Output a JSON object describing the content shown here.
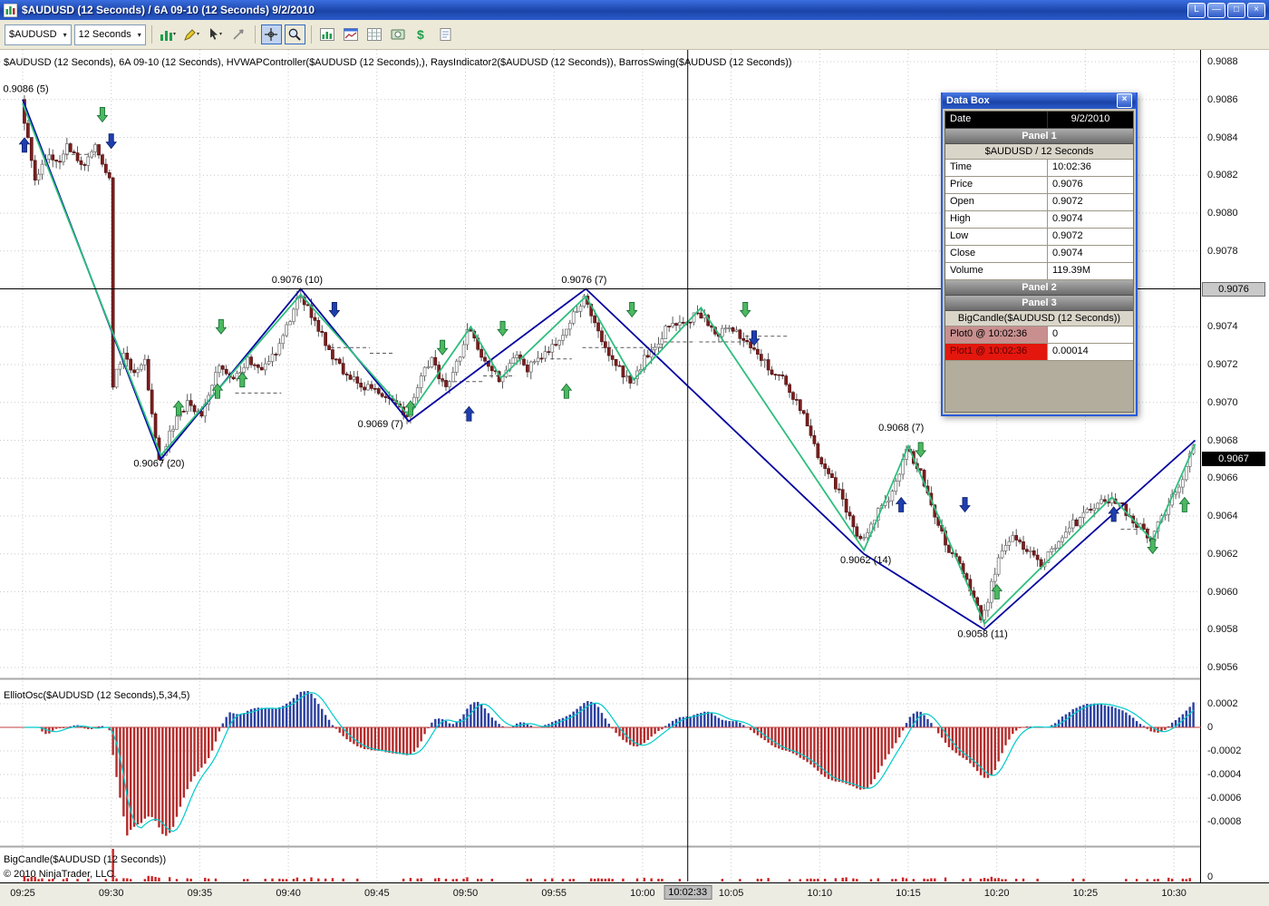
{
  "window": {
    "title": "$AUDUSD (12 Seconds) / 6A 09-10 (12 Seconds)  9/2/2010",
    "buttons": {
      "link": "L",
      "minimize": "—",
      "maximize": "□",
      "close": "×"
    }
  },
  "toolbar": {
    "instrument": "$AUDUSD",
    "interval": "12 Seconds",
    "icons": [
      "chart-style",
      "drawing-tools",
      "pointer",
      "marker",
      "crosshair",
      "zoom",
      "indicators",
      "chart-window",
      "data-grid",
      "snapshot",
      "dollar",
      "notes"
    ]
  },
  "chart": {
    "overlay_label": "$AUDUSD (12 Seconds), 6A 09-10 (12 Seconds), HVWAPController($AUDUSD (12 Seconds),), RaysIndicator2($AUDUSD (12 Seconds)), BarrosSwing($AUDUSD (12 Seconds))",
    "panel2_label": "ElliotOsc($AUDUSD (12 Seconds),5,34,5)",
    "panel3_label": "BigCandle($AUDUSD (12 Seconds))",
    "copyright": "© 2010 NinjaTrader, LLC."
  },
  "databox": {
    "title": "Data Box",
    "rows": [
      {
        "type": "kv-dark",
        "label": "Date",
        "value": "9/2/2010"
      },
      {
        "type": "header",
        "label": "Panel 1"
      },
      {
        "type": "subheader",
        "label": "$AUDUSD / 12 Seconds"
      },
      {
        "type": "kv",
        "label": "Time",
        "value": "10:02:36"
      },
      {
        "type": "kv",
        "label": "Price",
        "value": "0.9076"
      },
      {
        "type": "kv",
        "label": "Open",
        "value": "0.9072"
      },
      {
        "type": "kv",
        "label": "High",
        "value": "0.9074"
      },
      {
        "type": "kv",
        "label": "Low",
        "value": "0.9072"
      },
      {
        "type": "kv",
        "label": "Close",
        "value": "0.9074"
      },
      {
        "type": "kv",
        "label": "Volume",
        "value": "119.39M"
      },
      {
        "type": "header",
        "label": "Panel 2"
      },
      {
        "type": "header",
        "label": "Panel 3"
      },
      {
        "type": "subheader",
        "label": "BigCandle($AUDUSD (12 Seconds))"
      },
      {
        "type": "kv-plot0",
        "label": "Plot0 @ 10:02:36",
        "value": "0"
      },
      {
        "type": "kv-plot1",
        "label": "Plot1 @ 10:02:36",
        "value": "0.00014"
      }
    ]
  },
  "colors": {
    "candle_up_fill": "#FAFAFA",
    "candle_up_stroke": "#6E6E6E",
    "candle_down_fill": "#7C1F1F",
    "candle_down_stroke": "#551010",
    "wick": "#4A4A4A",
    "zigzag_blue": "#0000A0",
    "zigzag_green": "#2EBE7E",
    "hvwap": "#5A5A5A",
    "osc_pos": "#2B3F9E",
    "osc_neg": "#B42B2B",
    "signal": "#00CBCB",
    "zero_line": "#C04040",
    "bigcandle": "#CC2222",
    "grid": "#C9C9C9",
    "green_arrow": "#4CB860",
    "green_arrow_stroke": "#146A32",
    "blue_arrow": "#1E3EB0",
    "blue_arrow_stroke": "#0E2066"
  },
  "chart_data": {
    "type": "candlestick",
    "instrument": "$AUDUSD",
    "interval_seconds": 12,
    "x_axis": {
      "labels": [
        "09:25",
        "09:30",
        "09:35",
        "09:40",
        "09:45",
        "09:50",
        "09:55",
        "10:00",
        "10:05",
        "10:10",
        "10:15",
        "10:20",
        "10:25",
        "10:30"
      ],
      "minutes_per_label": 5
    },
    "crosshair": {
      "t_minutes": 37.55,
      "time_label": "10:02:33",
      "price": 0.9076,
      "price_label": "0.9076"
    },
    "panel1": {
      "yticks": [
        "0.9088",
        "0.9086",
        "0.9084",
        "0.9082",
        "0.9080",
        "0.9078",
        "0.9076",
        "0.9074",
        "0.9072",
        "0.9070",
        "0.9068",
        "0.9066",
        "0.9064",
        "0.9062",
        "0.9060",
        "0.9058",
        "0.9056"
      ],
      "ylim": [
        0.9056,
        0.9088
      ],
      "hline_price": 0.9076,
      "last_price": 0.9067,
      "last_price_label": "0.9067",
      "swing_labels": [
        {
          "t": -1.1,
          "price": 0.90864,
          "text": "0.9086 (5)",
          "anchor": "start"
        },
        {
          "t": 7.7,
          "price": 0.90666,
          "text": "0.9067 (20)",
          "anchor": "middle"
        },
        {
          "t": 15.5,
          "price": 0.90763,
          "text": "0.9076 (10)",
          "anchor": "middle"
        },
        {
          "t": 20.2,
          "price": 0.90687,
          "text": "0.9069 (7)",
          "anchor": "middle"
        },
        {
          "t": 31.7,
          "price": 0.90763,
          "text": "0.9076 (7)",
          "anchor": "middle"
        },
        {
          "t": 47.6,
          "price": 0.90615,
          "text": "0.9062 (14)",
          "anchor": "middle"
        },
        {
          "t": 49.6,
          "price": 0.90685,
          "text": "0.9068 (7)",
          "anchor": "middle"
        },
        {
          "t": 54.2,
          "price": 0.90576,
          "text": "0.9058 (11)",
          "anchor": "middle"
        }
      ],
      "zigzag_blue": [
        [
          0,
          0.9086
        ],
        [
          7.8,
          0.9067
        ],
        [
          15.7,
          0.9076
        ],
        [
          21.8,
          0.9069
        ],
        [
          31.8,
          0.9076
        ],
        [
          47.5,
          0.9062
        ],
        [
          54.3,
          0.9058
        ],
        [
          66.2,
          0.9068
        ]
      ],
      "zigzag_green": [
        [
          0,
          0.90858
        ],
        [
          7.8,
          0.90672
        ],
        [
          15.7,
          0.90757
        ],
        [
          21.8,
          0.90693
        ],
        [
          25.3,
          0.9074
        ],
        [
          27.0,
          0.90713
        ],
        [
          31.8,
          0.90756
        ],
        [
          34.5,
          0.90712
        ],
        [
          38.3,
          0.9075
        ],
        [
          47.5,
          0.90622
        ],
        [
          50.0,
          0.90677
        ],
        [
          54.3,
          0.90583
        ],
        [
          61.5,
          0.9065
        ],
        [
          63.8,
          0.90627
        ],
        [
          66.2,
          0.90678
        ]
      ],
      "price_path": [
        [
          0,
          0.9086
        ],
        [
          0.8,
          0.90815
        ],
        [
          1.6,
          0.90832
        ],
        [
          2.2,
          0.90825
        ],
        [
          2.6,
          0.90838
        ],
        [
          3.4,
          0.90825
        ],
        [
          4.2,
          0.90834
        ],
        [
          5.0,
          0.9082
        ],
        [
          5.2,
          0.9071
        ],
        [
          5.8,
          0.90726
        ],
        [
          6.4,
          0.90716
        ],
        [
          7.0,
          0.90722
        ],
        [
          7.8,
          0.90668
        ],
        [
          8.6,
          0.90688
        ],
        [
          9.4,
          0.907
        ],
        [
          10.2,
          0.90692
        ],
        [
          11.0,
          0.90718
        ],
        [
          12.0,
          0.90712
        ],
        [
          12.8,
          0.90722
        ],
        [
          13.6,
          0.90716
        ],
        [
          14.6,
          0.9073
        ],
        [
          15.7,
          0.90756
        ],
        [
          16.6,
          0.90744
        ],
        [
          17.4,
          0.90728
        ],
        [
          18.2,
          0.90716
        ],
        [
          19.0,
          0.90712
        ],
        [
          19.8,
          0.90706
        ],
        [
          20.6,
          0.90702
        ],
        [
          21.8,
          0.90692
        ],
        [
          22.6,
          0.90714
        ],
        [
          23.2,
          0.90722
        ],
        [
          24.0,
          0.90706
        ],
        [
          24.6,
          0.9072
        ],
        [
          25.3,
          0.9074
        ],
        [
          26.2,
          0.90722
        ],
        [
          27.0,
          0.90712
        ],
        [
          27.8,
          0.90726
        ],
        [
          28.6,
          0.90718
        ],
        [
          29.4,
          0.90724
        ],
        [
          30.4,
          0.90734
        ],
        [
          31.8,
          0.90755
        ],
        [
          32.6,
          0.90738
        ],
        [
          33.4,
          0.90722
        ],
        [
          34.5,
          0.9071
        ],
        [
          35.4,
          0.90726
        ],
        [
          36.4,
          0.90738
        ],
        [
          37.4,
          0.90742
        ],
        [
          38.3,
          0.90748
        ],
        [
          39.2,
          0.90736
        ],
        [
          40.2,
          0.90738
        ],
        [
          41.2,
          0.9073
        ],
        [
          42.2,
          0.90718
        ],
        [
          43.2,
          0.9071
        ],
        [
          44.2,
          0.90694
        ],
        [
          45.2,
          0.90668
        ],
        [
          46.2,
          0.90652
        ],
        [
          47.5,
          0.90624
        ],
        [
          48.4,
          0.90644
        ],
        [
          49.2,
          0.90652
        ],
        [
          50.0,
          0.90676
        ],
        [
          50.8,
          0.90662
        ],
        [
          51.6,
          0.90638
        ],
        [
          52.4,
          0.90622
        ],
        [
          53.2,
          0.90612
        ],
        [
          54.3,
          0.90585
        ],
        [
          55.2,
          0.90618
        ],
        [
          56.0,
          0.90632
        ],
        [
          56.8,
          0.90622
        ],
        [
          57.6,
          0.90614
        ],
        [
          58.4,
          0.90624
        ],
        [
          59.2,
          0.90634
        ],
        [
          60.0,
          0.9064
        ],
        [
          61.0,
          0.9065
        ],
        [
          61.8,
          0.90648
        ],
        [
          62.6,
          0.9064
        ],
        [
          63.8,
          0.90628
        ],
        [
          64.6,
          0.90642
        ],
        [
          65.4,
          0.90656
        ],
        [
          66.2,
          0.90676
        ]
      ],
      "markers": [
        {
          "t": 0.1,
          "price": 0.90836,
          "dir": "up",
          "color": "blue"
        },
        {
          "t": 4.5,
          "price": 0.90852,
          "dir": "down",
          "color": "green"
        },
        {
          "t": 5.0,
          "price": 0.90838,
          "dir": "down",
          "color": "blue"
        },
        {
          "t": 8.8,
          "price": 0.90697,
          "dir": "up",
          "color": "green"
        },
        {
          "t": 11.0,
          "price": 0.90706,
          "dir": "up",
          "color": "green"
        },
        {
          "t": 11.2,
          "price": 0.9074,
          "dir": "down",
          "color": "green"
        },
        {
          "t": 12.4,
          "price": 0.90712,
          "dir": "up",
          "color": "green"
        },
        {
          "t": 17.6,
          "price": 0.90749,
          "dir": "down",
          "color": "blue"
        },
        {
          "t": 21.9,
          "price": 0.90697,
          "dir": "up",
          "color": "green"
        },
        {
          "t": 23.7,
          "price": 0.90729,
          "dir": "down",
          "color": "green"
        },
        {
          "t": 25.2,
          "price": 0.90694,
          "dir": "up",
          "color": "blue"
        },
        {
          "t": 27.1,
          "price": 0.90739,
          "dir": "down",
          "color": "green"
        },
        {
          "t": 30.7,
          "price": 0.90706,
          "dir": "up",
          "color": "green"
        },
        {
          "t": 34.4,
          "price": 0.90749,
          "dir": "down",
          "color": "green"
        },
        {
          "t": 40.8,
          "price": 0.90749,
          "dir": "down",
          "color": "green"
        },
        {
          "t": 41.3,
          "price": 0.90734,
          "dir": "down",
          "color": "blue"
        },
        {
          "t": 49.6,
          "price": 0.90646,
          "dir": "up",
          "color": "blue"
        },
        {
          "t": 50.7,
          "price": 0.90675,
          "dir": "down",
          "color": "green"
        },
        {
          "t": 53.2,
          "price": 0.90646,
          "dir": "down",
          "color": "blue"
        },
        {
          "t": 55.0,
          "price": 0.906,
          "dir": "up",
          "color": "green"
        },
        {
          "t": 61.6,
          "price": 0.90641,
          "dir": "up",
          "color": "blue"
        },
        {
          "t": 63.8,
          "price": 0.90624,
          "dir": "down",
          "color": "green"
        },
        {
          "t": 65.6,
          "price": 0.90646,
          "dir": "up",
          "color": "green"
        }
      ]
    },
    "panel2": {
      "indicator": "ElliotOsc = SMA(5) - SMA(34) of close, signal = SMA(osc,5)",
      "yticks": [
        "0.0002",
        "0",
        "-0.0002",
        "-0.0004",
        "-0.0006",
        "-0.0008"
      ]
    },
    "panel3": {
      "indicator": "BigCandle = high-low range of each bar",
      "ytick": "0",
      "threshold": 8e-05,
      "scale_range": 0.0011
    }
  }
}
